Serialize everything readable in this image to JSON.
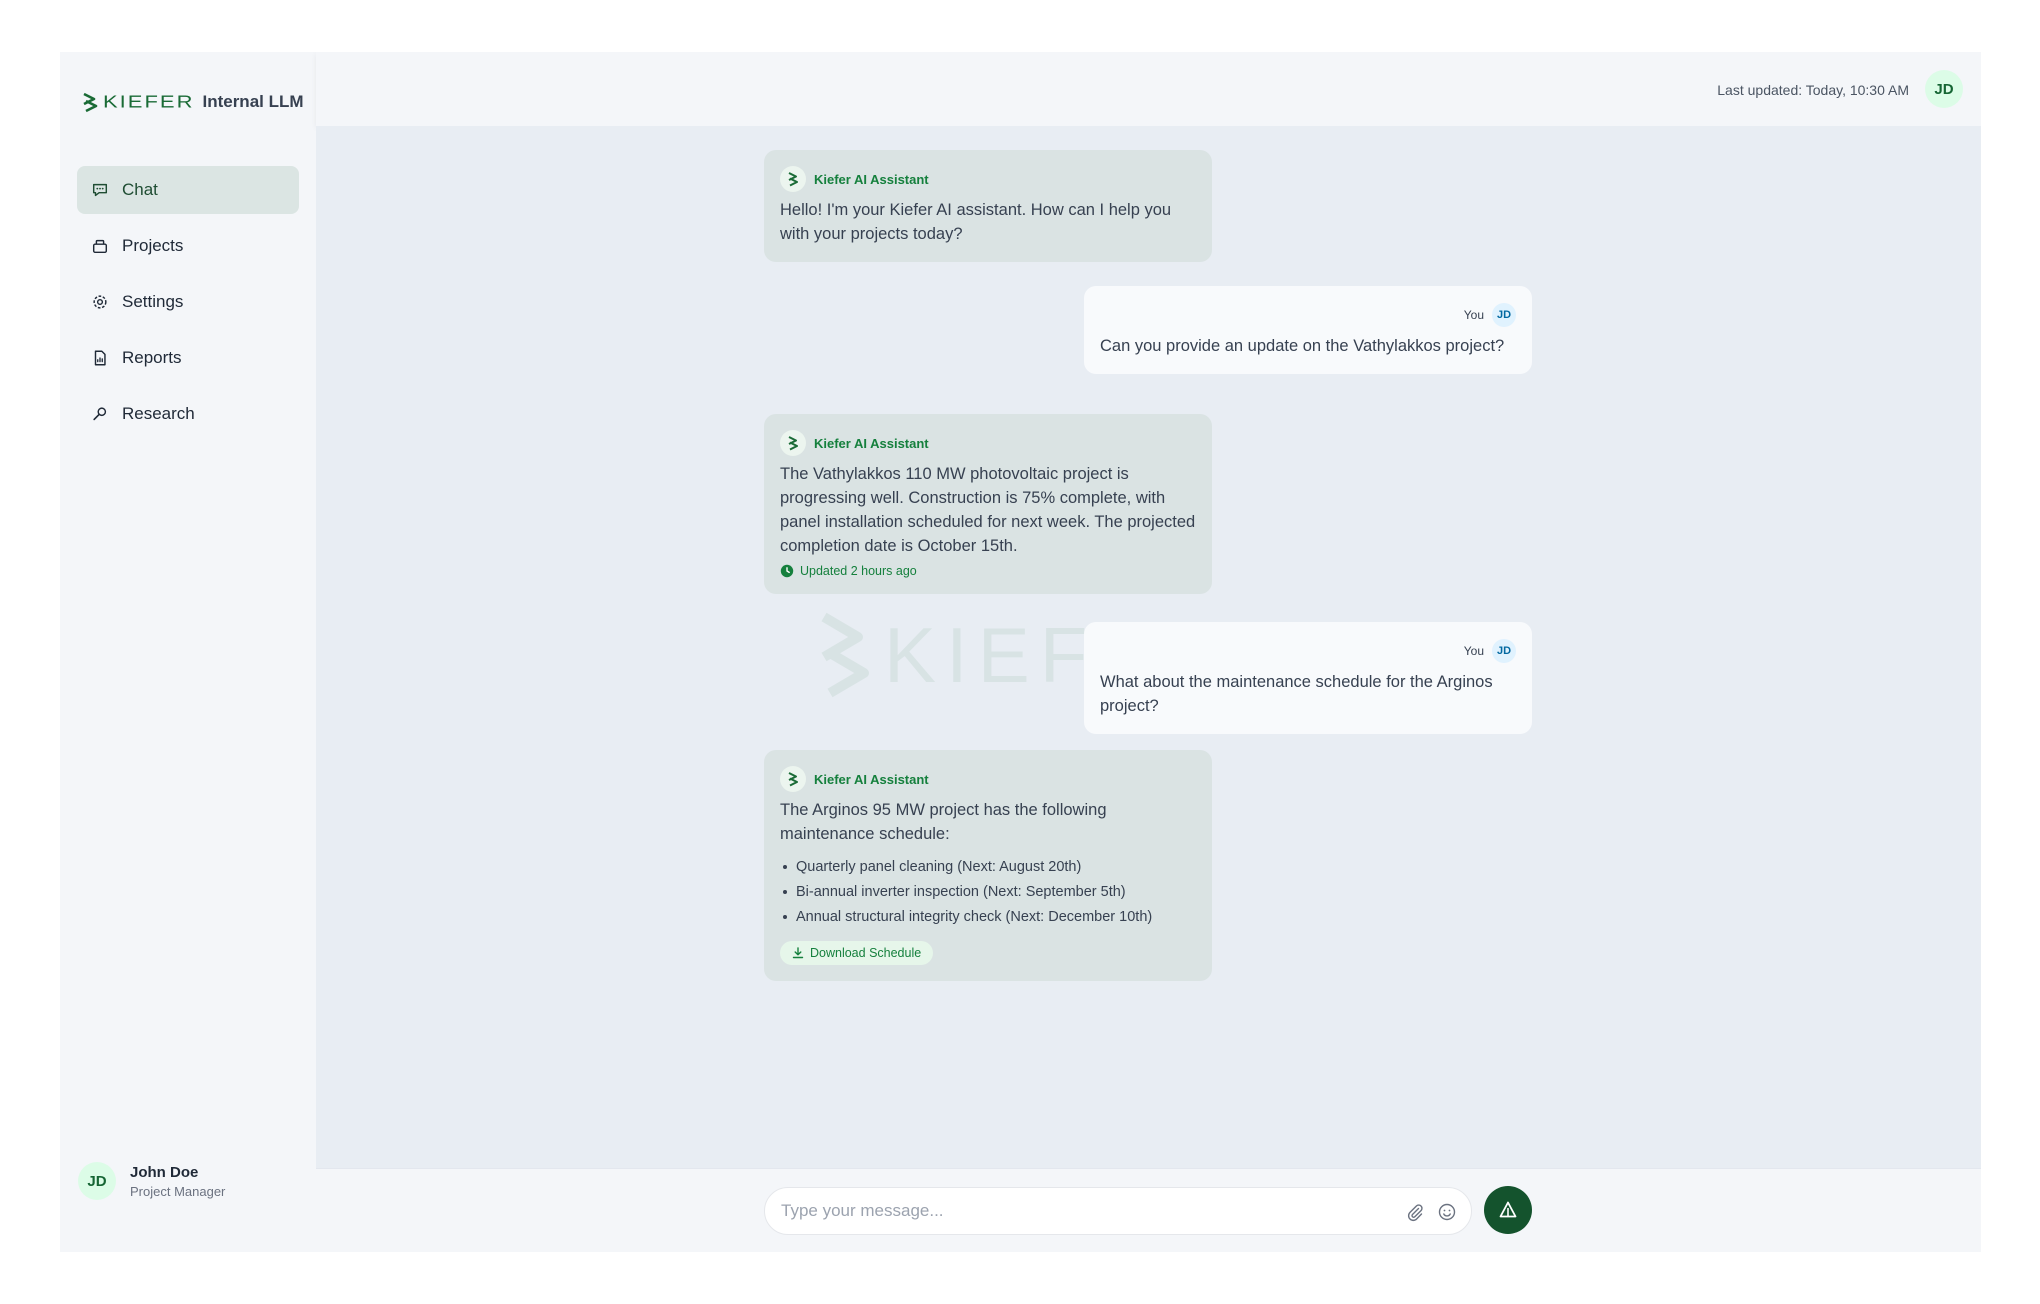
{
  "brand": {
    "wordmark": "KIEFER",
    "product": "Internal LLM",
    "color": "#1a6b36"
  },
  "sidebar": {
    "items": [
      {
        "label": "Chat",
        "icon": "chat-icon",
        "active": true
      },
      {
        "label": "Projects",
        "icon": "folder-icon",
        "active": false
      },
      {
        "label": "Settings",
        "icon": "gear-icon",
        "active": false
      },
      {
        "label": "Reports",
        "icon": "document-icon",
        "active": false
      },
      {
        "label": "Research",
        "icon": "search-icon",
        "active": false
      }
    ]
  },
  "user": {
    "initials": "JD",
    "name": "John Doe",
    "role": "Project Manager"
  },
  "header": {
    "last_updated": "Last updated: Today, 10:30 AM",
    "avatar_initials": "JD"
  },
  "watermark": {
    "text": "KIEFER"
  },
  "messages": [
    {
      "sender": "ai",
      "name": "Kiefer AI Assistant",
      "text": "Hello! I'm your Kiefer AI assistant. How can I help you with your projects today?"
    },
    {
      "sender": "user",
      "name": "You",
      "initials": "JD",
      "text": "Can you provide an update on the Vathylakkos project?"
    },
    {
      "sender": "ai",
      "name": "Kiefer AI Assistant",
      "text": "The Vathylakkos 110 MW photovoltaic project is progressing well. Construction is 75% complete, with panel installation scheduled for next week. The projected completion date is October 15th.",
      "meta": "Updated 2 hours ago"
    },
    {
      "sender": "user",
      "name": "You",
      "initials": "JD",
      "text": "What about the maintenance schedule for the Arginos project?"
    },
    {
      "sender": "ai",
      "name": "Kiefer AI Assistant",
      "text": "The Arginos 95 MW project has the following maintenance schedule:",
      "bullets": [
        "Quarterly panel cleaning (Next: August 20th)",
        "Bi-annual inverter inspection (Next: September 5th)",
        "Annual structural integrity check (Next: December 10th)"
      ],
      "action": "Download Schedule"
    }
  ],
  "composer": {
    "placeholder": "Type your message...",
    "value": ""
  },
  "colors": {
    "accent": "#14532d",
    "ai_bubble": "#dae3e3",
    "user_bubble": "#f8fafc",
    "active_nav": "#dbe5e3"
  }
}
